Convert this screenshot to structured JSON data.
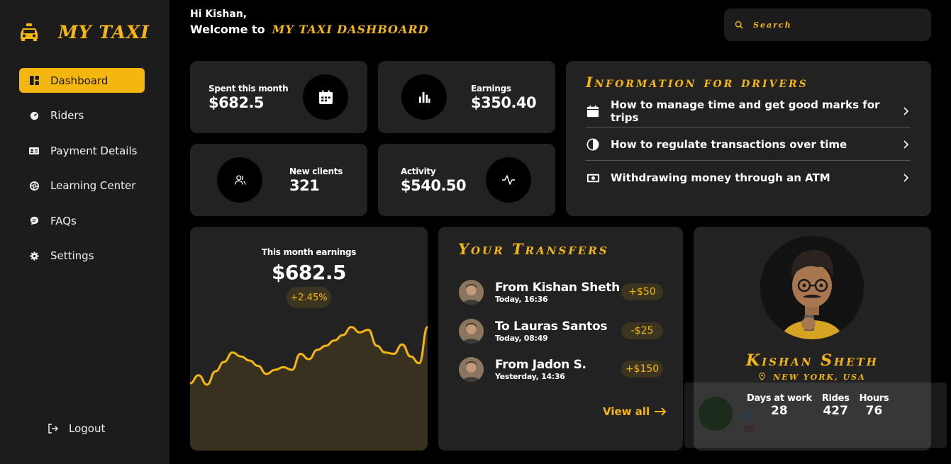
{
  "brand": {
    "name": "MY TAXI"
  },
  "sidebar": {
    "items": [
      {
        "label": "Dashboard",
        "icon": "dashboard-icon"
      },
      {
        "label": "Riders",
        "icon": "speedometer-icon"
      },
      {
        "label": "Payment Details",
        "icon": "id-card-icon"
      },
      {
        "label": "Learning Center",
        "icon": "aperture-icon"
      },
      {
        "label": "FAQs",
        "icon": "chat-icon"
      },
      {
        "label": "Settings",
        "icon": "gear-icon"
      }
    ],
    "logout": "Logout"
  },
  "header": {
    "greeting": "Hi Kishan,",
    "welcome": "Welcome to",
    "dashboard_name": "MY TAXI DASHBOARD"
  },
  "search": {
    "placeholder": "Search"
  },
  "stats": {
    "spent": {
      "label": "Spent this month",
      "value": "$682.5",
      "icon": "calendar-icon"
    },
    "earnings": {
      "label": "Earnings",
      "value": "$350.40",
      "icon": "bar-chart-icon"
    },
    "new_clients": {
      "label": "New clients",
      "value": "321",
      "icon": "users-icon"
    },
    "activity": {
      "label": "Activity",
      "value": "$540.50",
      "icon": "pulse-icon"
    }
  },
  "info": {
    "title": "Information for drivers",
    "items": [
      {
        "label": "How to manage time and get good marks for trips",
        "icon": "calendar-icon"
      },
      {
        "label": "How to regulate transactions over time",
        "icon": "contrast-icon"
      },
      {
        "label": "Withdrawing money through an ATM",
        "icon": "cash-icon"
      }
    ]
  },
  "earnings_card": {
    "label": "This month earnings",
    "value": "$682.5",
    "change": "+2.45%"
  },
  "chart_data": {
    "type": "area",
    "title": "This month earnings",
    "xlabel": "",
    "ylabel": "",
    "series": [
      {
        "values": [
          10,
          16,
          9,
          19,
          26,
          33,
          30,
          27,
          23,
          17,
          20,
          22,
          20,
          32,
          28,
          35,
          38,
          42,
          46,
          52,
          48,
          50,
          38,
          33,
          32,
          39,
          30,
          25,
          52
        ]
      }
    ],
    "accent": "#f5b70f",
    "fill": "#38311f",
    "grid": false
  },
  "transfers": {
    "title": "Your Transfers",
    "items": [
      {
        "name": "From Kishan Sheth",
        "time": "Today, 16:36",
        "amount": "+$50"
      },
      {
        "name": "To Lauras Santos",
        "time": "Today, 08:49",
        "amount": "-$25"
      },
      {
        "name": "From Jadon S.",
        "time": "Yesterday, 14:36",
        "amount": "+$150"
      }
    ],
    "view_all": "View all"
  },
  "profile": {
    "name": "Kishan Sheth",
    "location": "New York, USA",
    "stats": [
      {
        "label": "Days at work",
        "value": "28"
      },
      {
        "label": "Rides",
        "value": "427"
      },
      {
        "label": "Hours",
        "value": "76"
      }
    ]
  },
  "colors": {
    "accent": "#f5b70f",
    "card": "#222222",
    "sidebar": "#1c1c1c",
    "background": "#000000"
  }
}
